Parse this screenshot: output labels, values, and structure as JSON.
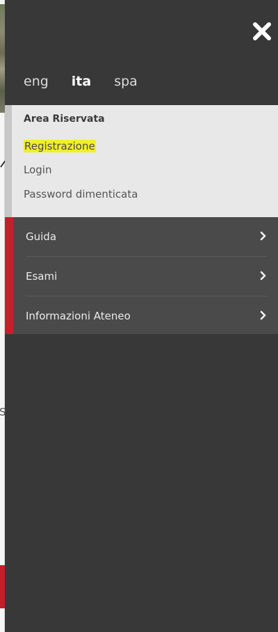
{
  "background": {
    "text_fragment": "S"
  },
  "close": {
    "icon": "close-icon"
  },
  "languages": [
    {
      "label": "eng",
      "active": false
    },
    {
      "label": "ita",
      "active": true
    },
    {
      "label": "spa",
      "active": false
    }
  ],
  "reserved_area": {
    "title": "Area Riservata",
    "links": [
      {
        "label": "Registrazione",
        "highlighted": true
      },
      {
        "label": "Login",
        "highlighted": false
      },
      {
        "label": "Password dimenticata",
        "highlighted": false
      }
    ]
  },
  "menu": {
    "items": [
      {
        "label": "Guida",
        "icon": "chevron-right-icon"
      },
      {
        "label": "Esami",
        "icon": "chevron-right-icon"
      },
      {
        "label": "Informazioni Ateneo",
        "icon": "chevron-right-icon"
      }
    ]
  },
  "colors": {
    "panel": "#383838",
    "menu": "#4a4a4a",
    "accent_red": "#c3202c",
    "highlight": "#f2ef2a"
  }
}
